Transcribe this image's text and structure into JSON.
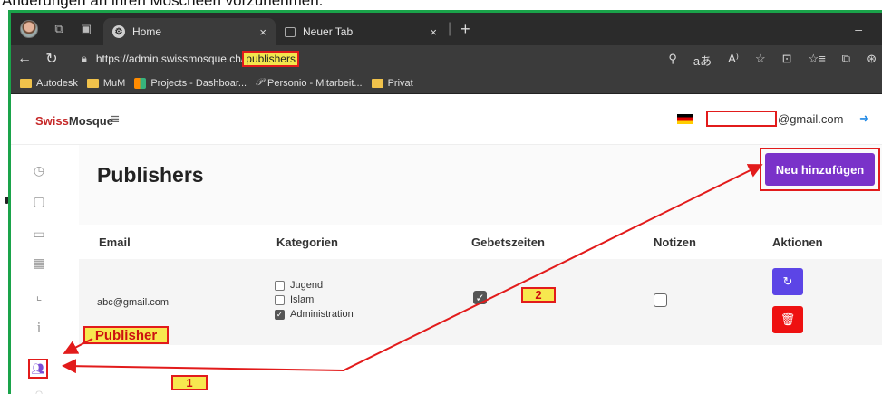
{
  "caption": "Änderungen an ihren Moscheen vorzunehmen.",
  "browser": {
    "tabs": [
      {
        "title": "Home",
        "close": "×"
      },
      {
        "title": "Neuer Tab",
        "close": "×"
      }
    ],
    "new_tab": "+",
    "window_control": "–",
    "url_prefix": "https://admin.swissmosque.ch/",
    "url_highlight": "publishers",
    "toolbar_icons": [
      "ai-icon",
      "translate-icon",
      "read-aloud-icon",
      "favorite-icon",
      "split-screen-icon",
      "favorites-list-icon",
      "collections-icon",
      "extensions-icon"
    ],
    "toolbar_glyphs": [
      "⚲",
      "aあ",
      "A⁾",
      "☆",
      "⊡",
      "☆≡",
      "⧉",
      "⊛"
    ],
    "bookmarks": [
      {
        "label": "Autodesk",
        "icon": "folder-icon"
      },
      {
        "label": "MuM",
        "icon": "folder-icon"
      },
      {
        "label": "Projects - Dashboar...",
        "icon": "jira-icon"
      },
      {
        "label": "Personio - Mitarbeit...",
        "icon": "personio-icon"
      },
      {
        "label": "Privat",
        "icon": "folder-icon"
      }
    ]
  },
  "app": {
    "brand_a": "Swiss",
    "brand_b": "Mosque",
    "email_suffix": "@gmail.com",
    "page_title": "Publishers",
    "add_button": "Neu hinzufügen",
    "columns": [
      "Email",
      "Kategorien",
      "Gebetszeiten",
      "Notizen",
      "Aktionen"
    ],
    "rows": [
      {
        "email": "abc@gmail.com",
        "categories": [
          {
            "label": "Jugend",
            "checked": false
          },
          {
            "label": "Islam",
            "checked": false
          },
          {
            "label": "Administration",
            "checked": true
          }
        ],
        "gebetszeiten": true,
        "notizen": false
      }
    ],
    "sidebar_icons": [
      "clock-icon",
      "note-icon",
      "chat-icon",
      "calendar-icon",
      "chart-icon",
      "info-icon",
      "users-icon",
      "message-icon"
    ]
  },
  "annotations": {
    "label_1": "1",
    "label_2": "2",
    "label_publisher": "Publisher",
    "color": "#e21b1b",
    "fill": "#f7e84f"
  }
}
